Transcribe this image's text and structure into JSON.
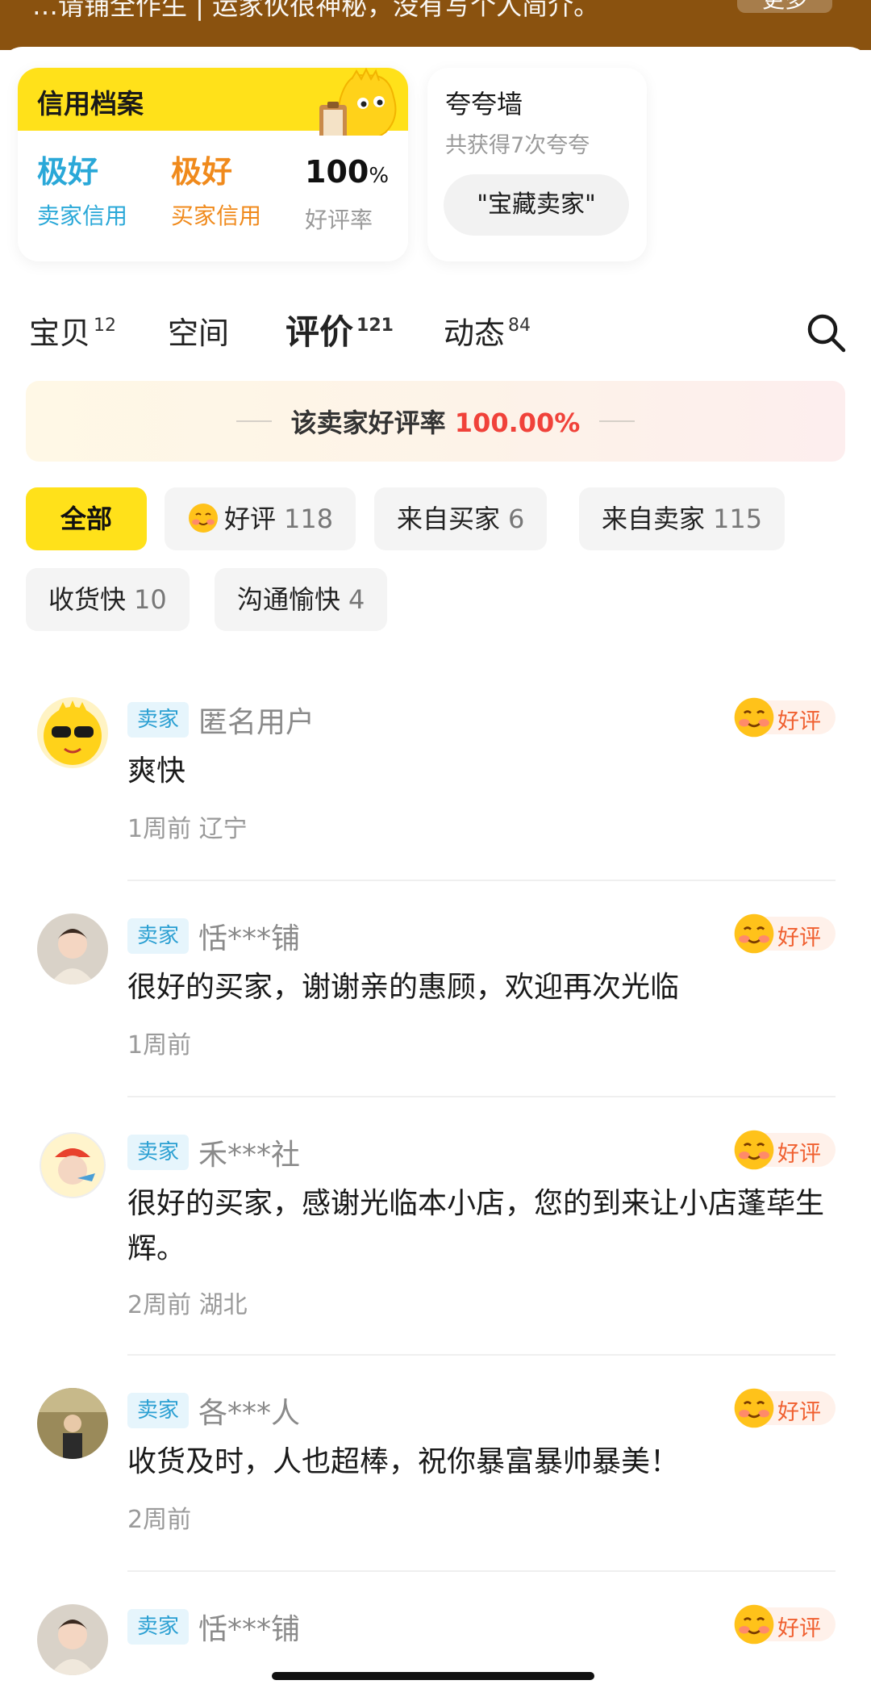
{
  "banner": {
    "text": "…请铺全作生 | 运家伙很神秘，没有写个人简介。",
    "more_label": "更多"
  },
  "credit": {
    "title": "信用档案",
    "seller": {
      "value": "极好",
      "label": "卖家信用"
    },
    "buyer": {
      "value": "极好",
      "label": "买家信用"
    },
    "rate": {
      "value": "100",
      "unit": "%",
      "label": "好评率"
    }
  },
  "praise": {
    "title": "夸夸墙",
    "subtitle": "共获得7次夸夸",
    "tag": "\"宝藏卖家\""
  },
  "tabs": [
    {
      "label": "宝贝",
      "count": "12"
    },
    {
      "label": "空间",
      "count": ""
    },
    {
      "label": "评价",
      "count": "121"
    },
    {
      "label": "动态",
      "count": "84"
    }
  ],
  "rate_banner": {
    "prefix": "该卖家好评率",
    "value": "100.00%"
  },
  "filters": [
    {
      "label": "全部",
      "count": ""
    },
    {
      "label": "好评",
      "count": "118"
    },
    {
      "label": "来自买家",
      "count": "6"
    },
    {
      "label": "来自卖家",
      "count": "115"
    },
    {
      "label": "收货快",
      "count": "10"
    },
    {
      "label": "沟通愉快",
      "count": "4"
    }
  ],
  "reviews": [
    {
      "role": "卖家",
      "name": "匿名用户",
      "badge": "好评",
      "text": "爽快",
      "meta": "1周前  辽宁"
    },
    {
      "role": "卖家",
      "name": "恬***铺",
      "badge": "好评",
      "text": "很好的买家，谢谢亲的惠顾，欢迎再次光临",
      "meta": "1周前"
    },
    {
      "role": "卖家",
      "name": "禾***社",
      "badge": "好评",
      "text": "很好的买家，感谢光临本小店，您的到来让小店蓬荜生辉。",
      "meta": "2周前  湖北"
    },
    {
      "role": "卖家",
      "name": "各***人",
      "badge": "好评",
      "text": "收货及时，人也超棒，祝你暴富暴帅暴美！",
      "meta": "2周前"
    },
    {
      "role": "卖家",
      "name": "恬***铺",
      "badge": "好评",
      "text": "",
      "meta": ""
    }
  ],
  "colors": {
    "brand_yellow": "#ffe11a",
    "banner_brown": "#8a520f",
    "seller_blue": "#2aa8d8",
    "buyer_orange": "#f08a1c",
    "rate_red": "#f0423a"
  },
  "icons": {
    "search": "search-icon",
    "good_review": "smile-emoji-icon",
    "mascot": "yellow-fish-mascot"
  }
}
